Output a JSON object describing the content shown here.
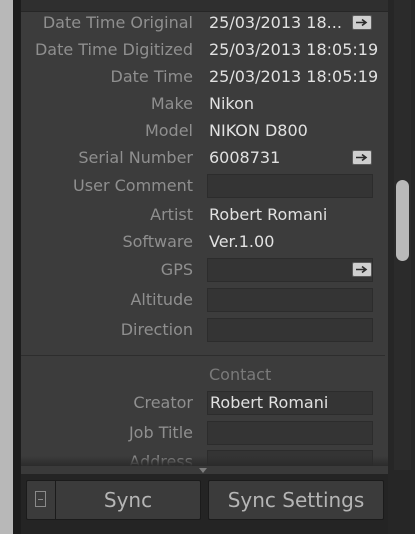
{
  "metadata": {
    "rows": [
      {
        "label": "Date Time Original",
        "value": "25/03/2013 18...",
        "has_jump": true
      },
      {
        "label": "Date Time Digitized",
        "value": "25/03/2013 18:05:19"
      },
      {
        "label": "Date Time",
        "value": "25/03/2013 18:05:19"
      },
      {
        "label": "Make",
        "value": "Nikon"
      },
      {
        "label": "Model",
        "value": "NIKON D800"
      },
      {
        "label": "Serial Number",
        "value": "6008731",
        "has_jump": true
      },
      {
        "label": "User Comment",
        "value": ""
      },
      {
        "label": "Artist",
        "value": "Robert Romani"
      },
      {
        "label": "Software",
        "value": "Ver.1.00"
      },
      {
        "label": "GPS",
        "value": "",
        "has_jump": true
      },
      {
        "label": "Altitude",
        "value": ""
      },
      {
        "label": "Direction",
        "value": ""
      }
    ]
  },
  "contact": {
    "section_label": "Contact",
    "rows": [
      {
        "label": "Creator",
        "value": "Robert Romani"
      },
      {
        "label": "Job Title",
        "value": ""
      },
      {
        "label": "Address",
        "value": ""
      }
    ]
  },
  "footer": {
    "sync_label": "Sync",
    "sync_settings_label": "Sync Settings"
  },
  "icons": {
    "jump": "arrow-right-icon",
    "sync_toggle": "sync-toggle-icon",
    "collapse": "triangle-down-icon"
  },
  "colors": {
    "panel_bg": "#3c3c3c",
    "label": "#8f8f8f",
    "value": "#e1e1e1",
    "scroll_thumb": "#b9b9b9"
  }
}
